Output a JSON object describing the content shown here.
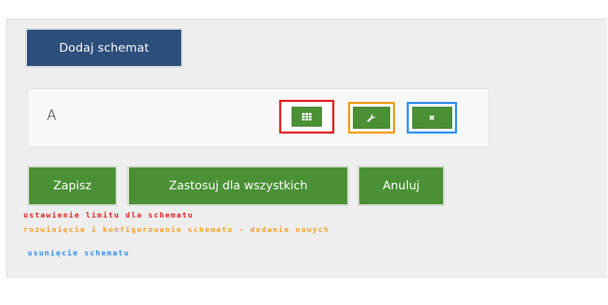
{
  "toolbar": {
    "add_schema_label": "Dodaj schemat"
  },
  "schema_row": {
    "name": "A",
    "limit_icon": "calendar-grid-icon",
    "config_icon": "wrench-icon",
    "delete_icon": "close-x-icon",
    "delete_glyph": "✖"
  },
  "actions": {
    "save_label": "Zapisz",
    "apply_all_label": "Zastosuj dla wszystkich",
    "cancel_label": "Anuluj"
  },
  "legend": {
    "limit": "ustawienie limitu dla schematu",
    "config": "rozwinięcie i konfigurowanie schematu - dodanie nowych",
    "delete": "usunięcie schematu"
  },
  "colors": {
    "primary_button": "#2e4e7c",
    "action_button": "#4a9135",
    "highlight_limit": "#e21f1f",
    "highlight_config": "#f39c12",
    "highlight_delete": "#2e8ff0"
  }
}
